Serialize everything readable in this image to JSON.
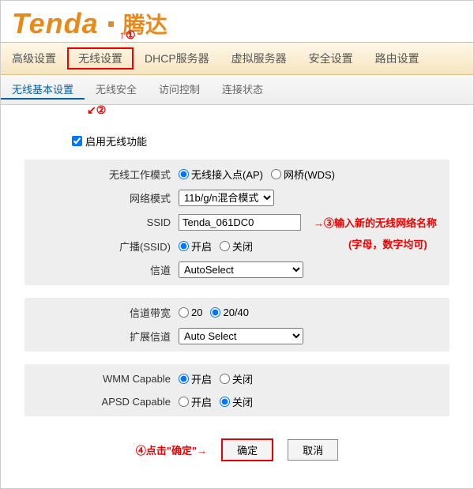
{
  "logo": {
    "text": "Tenda",
    "cn": "腾达"
  },
  "mainNav": [
    "高级设置",
    "无线设置",
    "DHCP服务器",
    "虚拟服务器",
    "安全设置",
    "路由设置"
  ],
  "subNav": [
    "无线基本设置",
    "无线安全",
    "访问控制",
    "连接状态"
  ],
  "enable": {
    "label": "启用无线功能",
    "checked": true
  },
  "fields": {
    "workMode": {
      "label": "无线工作模式",
      "opt1": "无线接入点(AP)",
      "opt2": "网桥(WDS)",
      "value": "ap"
    },
    "netMode": {
      "label": "网络模式",
      "value": "11b/g/n混合模式"
    },
    "ssid": {
      "label": "SSID",
      "value": "Tenda_061DC0"
    },
    "broadcast": {
      "label": "广播(SSID)",
      "on": "开启",
      "off": "关闭",
      "value": "on"
    },
    "channel": {
      "label": "信道",
      "value": "AutoSelect"
    },
    "bandwidth": {
      "label": "信道带宽",
      "opt1": "20",
      "opt2": "20/40",
      "value": "20/40"
    },
    "extChannel": {
      "label": "扩展信道",
      "value": "Auto Select"
    },
    "wmm": {
      "label": "WMM Capable",
      "on": "开启",
      "off": "关闭",
      "value": "on"
    },
    "apsd": {
      "label": "APSD Capable",
      "on": "开启",
      "off": "关闭",
      "value": "off"
    }
  },
  "buttons": {
    "ok": "确定",
    "cancel": "取消"
  },
  "annot": {
    "n1": "①",
    "n2": "②",
    "n3": "③",
    "n4": "④",
    "ssidTip": "输入新的无线网络名称",
    "ssidSub": "(字母，数字均可)",
    "btnTip": "点击\"确定\"",
    "arrow": "→"
  }
}
